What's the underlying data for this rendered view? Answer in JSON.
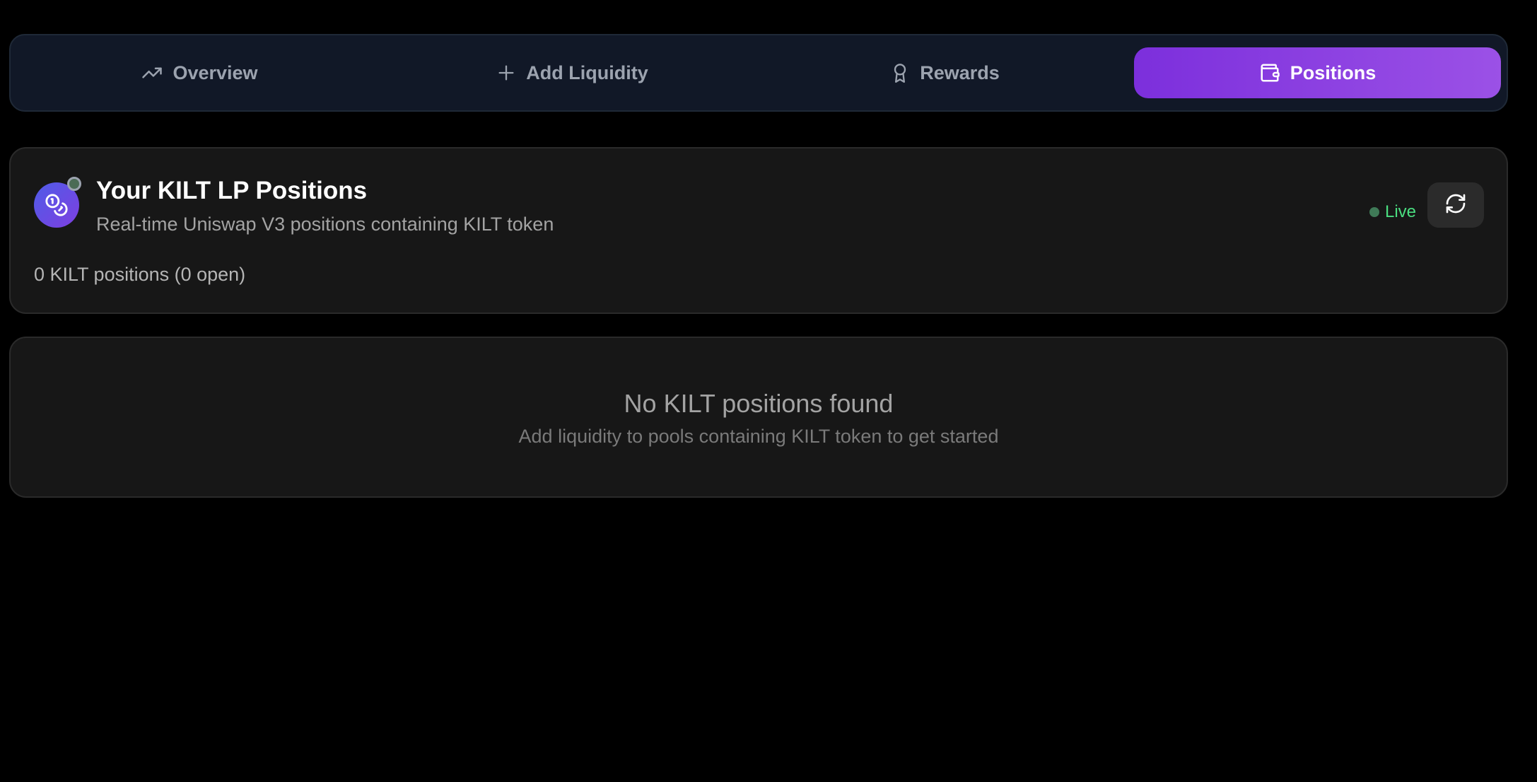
{
  "tabs": [
    {
      "label": "Overview",
      "icon": "trending-up-icon",
      "active": false
    },
    {
      "label": "Add Liquidity",
      "icon": "plus-icon",
      "active": false
    },
    {
      "label": "Rewards",
      "icon": "award-icon",
      "active": false
    },
    {
      "label": "Positions",
      "icon": "wallet-icon",
      "active": true
    }
  ],
  "positions_card": {
    "title": "Your KILT LP Positions",
    "subtitle": "Real-time Uniswap V3 positions containing KILT token",
    "count_text": "0 KILT positions (0 open)",
    "status": "Live",
    "logo_icon": "coins-icon",
    "refresh_icon": "refresh-icon"
  },
  "empty_state": {
    "title": "No KILT positions found",
    "subtitle": "Add liquidity to pools containing KILT token to get started"
  },
  "colors": {
    "accent": "#7c2fdc",
    "live": "#4ade80",
    "background": "#000000",
    "card": "#171717"
  }
}
